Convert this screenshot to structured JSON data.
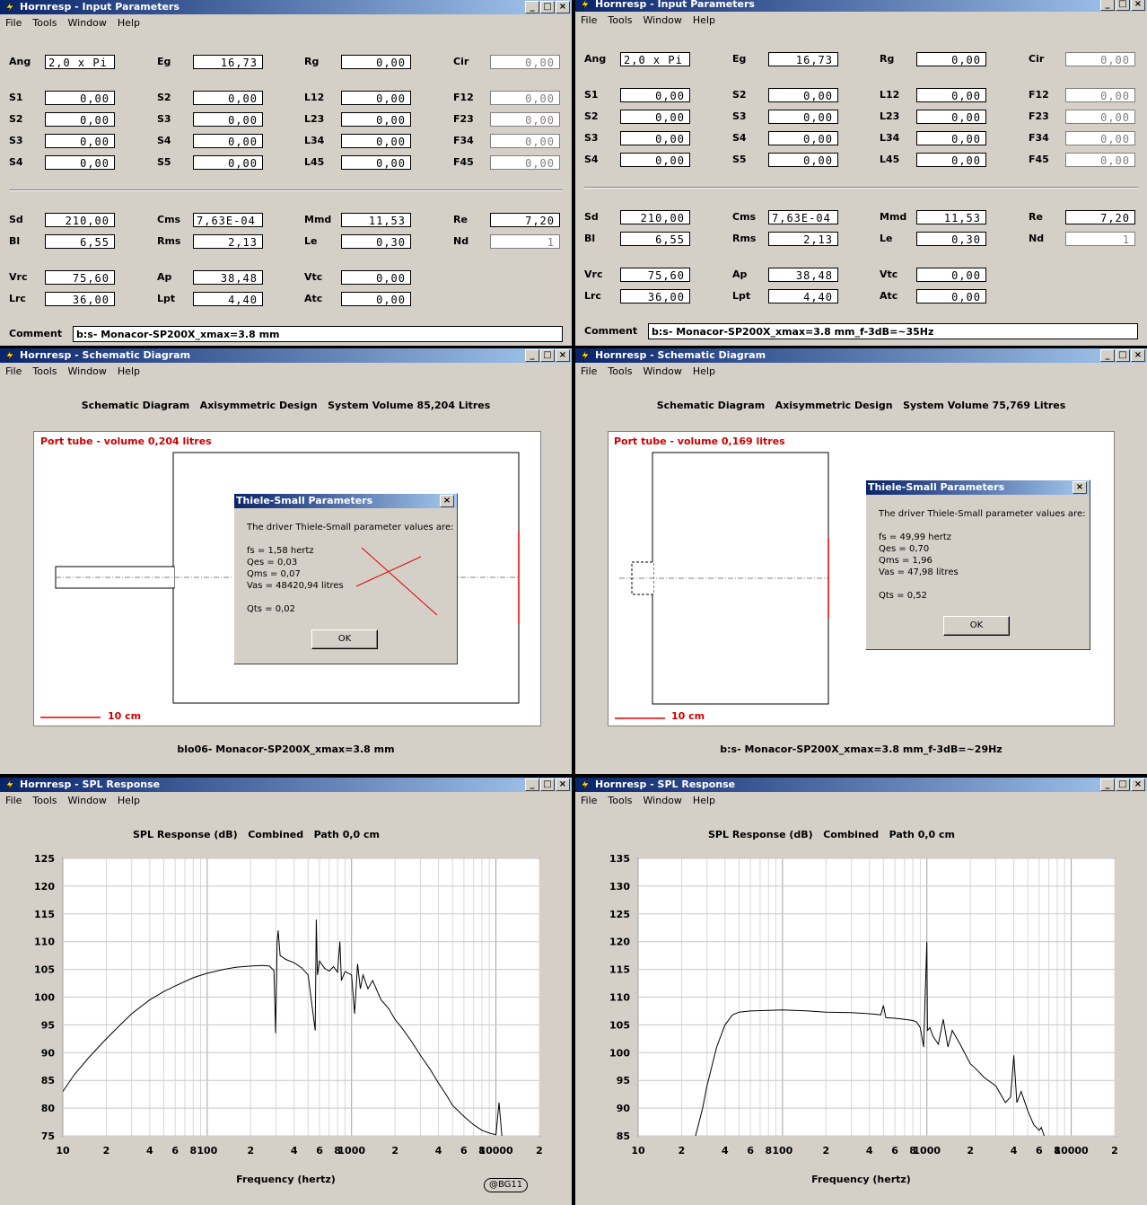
{
  "menu": [
    "File",
    "Tools",
    "Window",
    "Help"
  ],
  "input_left": {
    "title": "Hornresp - Input Parameters",
    "rows": [
      {
        "cells": [
          [
            "Ang",
            "2,0 x Pi",
            "left"
          ],
          [
            "Eg",
            "16,73",
            ""
          ],
          [
            "Rg",
            "0,00",
            ""
          ],
          [
            "Cir",
            "0,00",
            "dis"
          ]
        ]
      },
      {
        "cells": [
          [
            "S1",
            "0,00",
            ""
          ],
          [
            "S2",
            "0,00",
            ""
          ],
          [
            "L12",
            "0,00",
            ""
          ],
          [
            "F12",
            "0,00",
            "dis"
          ]
        ]
      },
      {
        "cells": [
          [
            "S2",
            "0,00",
            ""
          ],
          [
            "S3",
            "0,00",
            ""
          ],
          [
            "L23",
            "0,00",
            ""
          ],
          [
            "F23",
            "0,00",
            "dis"
          ]
        ]
      },
      {
        "cells": [
          [
            "S3",
            "0,00",
            ""
          ],
          [
            "S4",
            "0,00",
            ""
          ],
          [
            "L34",
            "0,00",
            ""
          ],
          [
            "F34",
            "0,00",
            "dis"
          ]
        ]
      },
      {
        "cells": [
          [
            "S4",
            "0,00",
            ""
          ],
          [
            "S5",
            "0,00",
            ""
          ],
          [
            "L45",
            "0,00",
            ""
          ],
          [
            "F45",
            "0,00",
            "dis"
          ]
        ]
      },
      {
        "cells": [
          [
            "Sd",
            "210,00",
            ""
          ],
          [
            "Cms",
            "7,63E-04",
            "left"
          ],
          [
            "Mmd",
            "11,53",
            ""
          ],
          [
            "Re",
            "7,20",
            ""
          ]
        ]
      },
      {
        "cells": [
          [
            "Bl",
            "6,55",
            ""
          ],
          [
            "Rms",
            "2,13",
            ""
          ],
          [
            "Le",
            "0,30",
            ""
          ],
          [
            "Nd",
            "1",
            "dis"
          ]
        ]
      },
      {
        "cells": [
          [
            "Vrc",
            "75,60",
            ""
          ],
          [
            "Ap",
            "38,48",
            ""
          ],
          [
            "Vtc",
            "0,00",
            ""
          ]
        ]
      },
      {
        "cells": [
          [
            "Lrc",
            "36,00",
            ""
          ],
          [
            "Lpt",
            "4,40",
            ""
          ],
          [
            "Atc",
            "0,00",
            ""
          ]
        ]
      }
    ],
    "comment_label": "Comment",
    "comment": "b:s- Monacor-SP200X_xmax=3.8 mm"
  },
  "input_right": {
    "title": "Hornresp - Input Parameters",
    "comment_label": "Comment",
    "comment": "b:s- Monacor-SP200X_xmax=3.8 mm_f-3dB=~35Hz"
  },
  "schem_left": {
    "title": "Hornresp - Schematic Diagram",
    "heading": "Schematic Diagram   Axisymmetric Design   System Volume 85,204 Litres",
    "port": "Port tube - volume 0,204 litres",
    "scale": "10 cm",
    "caption": "blo06- Monacor-SP200X_xmax=3.8 mm",
    "dialog": {
      "title": "Thiele-Small Parameters",
      "intro": "The driver Thiele-Small parameter values are:",
      "fs": "fs = 1,58 hertz",
      "qes": "Qes = 0,03",
      "qms": "Qms = 0,07",
      "vas": "Vas = 48420,94 litres",
      "qts": "Qts = 0,02",
      "ok": "OK"
    }
  },
  "schem_right": {
    "title": "Hornresp - Schematic Diagram",
    "heading": "Schematic Diagram   Axisymmetric Design   System Volume 75,769 Litres",
    "port": "Port tube - volume 0,169 litres",
    "scale": "10 cm",
    "caption": "b:s- Monacor-SP200X_xmax=3.8 mm_f-3dB=~29Hz",
    "dialog": {
      "title": "Thiele-Small Parameters",
      "intro": "The driver Thiele-Small parameter values are:",
      "fs": "fs = 49,99 hertz",
      "qes": "Qes = 0,70",
      "qms": "Qms = 1,96",
      "vas": "Vas = 47,98 litres",
      "qts": "Qts = 0,52",
      "ok": "OK"
    }
  },
  "spl_left": {
    "title": "Hornresp - SPL Response",
    "heading": "SPL Response (dB)   Combined   Path 0,0 cm",
    "stamp": "@BG11"
  },
  "spl_right": {
    "title": "Hornresp - SPL Response",
    "heading": "SPL Response (dB)   Combined   Path 0,0 cm"
  },
  "chart_data": [
    {
      "type": "line",
      "title": "SPL Response (dB)   Combined   Path 0,0 cm",
      "xlabel": "Frequency (hertz)",
      "ylabel": "",
      "xscale": "log",
      "xlim": [
        10,
        20000
      ],
      "ylim": [
        75,
        125
      ],
      "xticks": [
        "10",
        "2",
        "4",
        "6",
        "8",
        "100",
        "2",
        "4",
        "6",
        "8",
        "1000",
        "2",
        "4",
        "6",
        "8",
        "10000",
        "2"
      ],
      "yticks": [
        "125",
        "120",
        "115",
        "110",
        "105",
        "100",
        "95",
        "90",
        "85",
        "80",
        "75"
      ],
      "grid": true,
      "x": [
        10,
        12,
        15,
        20,
        25,
        30,
        40,
        50,
        60,
        80,
        100,
        130,
        160,
        200,
        240,
        270,
        290,
        295,
        298,
        305,
        310,
        320,
        350,
        400,
        450,
        500,
        560,
        570,
        580,
        600,
        650,
        700,
        750,
        800,
        830,
        850,
        900,
        1000,
        1050,
        1100,
        1150,
        1200,
        1300,
        1400,
        1600,
        1800,
        2000,
        2300,
        2600,
        3000,
        3500,
        4000,
        4500,
        5000,
        6000,
        7000,
        8000,
        9000,
        10000,
        10500,
        11000
      ],
      "values": [
        83,
        86,
        89,
        92.5,
        95,
        97,
        99.5,
        101,
        102,
        103.5,
        104.3,
        105,
        105.4,
        105.6,
        105.7,
        105.6,
        104.8,
        98,
        93.5,
        110,
        112,
        107.5,
        106.8,
        106.2,
        105.3,
        104,
        94,
        114,
        104,
        106.5,
        105.2,
        104.7,
        105.5,
        104.5,
        110,
        103,
        104.6,
        104,
        97,
        106,
        101.5,
        104,
        101.5,
        103,
        99.5,
        98,
        96,
        94,
        92,
        89.5,
        87,
        84.5,
        82.5,
        80.5,
        78.5,
        77,
        76,
        75.5,
        75.2,
        81,
        75
      ]
    },
    {
      "type": "line",
      "title": "SPL Response (dB)   Combined   Path 0,0 cm",
      "xlabel": "Frequency (hertz)",
      "ylabel": "",
      "xscale": "log",
      "xlim": [
        10,
        20000
      ],
      "ylim": [
        85,
        135
      ],
      "xticks": [
        "10",
        "2",
        "4",
        "6",
        "8",
        "100",
        "2",
        "4",
        "6",
        "8",
        "1000",
        "2",
        "4",
        "6",
        "8",
        "10000",
        "2"
      ],
      "yticks": [
        "135",
        "130",
        "125",
        "120",
        "115",
        "110",
        "105",
        "100",
        "95",
        "90",
        "85"
      ],
      "grid": true,
      "x": [
        25,
        28,
        30,
        35,
        40,
        45,
        50,
        60,
        80,
        100,
        150,
        200,
        300,
        400,
        450,
        480,
        500,
        520,
        600,
        700,
        800,
        850,
        900,
        950,
        1000,
        1010,
        1050,
        1100,
        1200,
        1300,
        1400,
        1500,
        1700,
        2000,
        2200,
        2500,
        3000,
        3500,
        3800,
        4000,
        4200,
        4500,
        5000,
        5500,
        6000,
        6200,
        6500
      ],
      "values": [
        85,
        90,
        94,
        101,
        105,
        106.8,
        107.3,
        107.5,
        107.6,
        107.7,
        107.5,
        107.3,
        107.2,
        107,
        106.9,
        106.8,
        108.5,
        106.3,
        106.2,
        106,
        105.8,
        105.5,
        104.5,
        101,
        120,
        104,
        104.5,
        103,
        101.5,
        106,
        101,
        104,
        101.5,
        98,
        97,
        95.5,
        94,
        91,
        92,
        99.5,
        91,
        93,
        89.5,
        87,
        86,
        86.5,
        85
      ]
    }
  ]
}
